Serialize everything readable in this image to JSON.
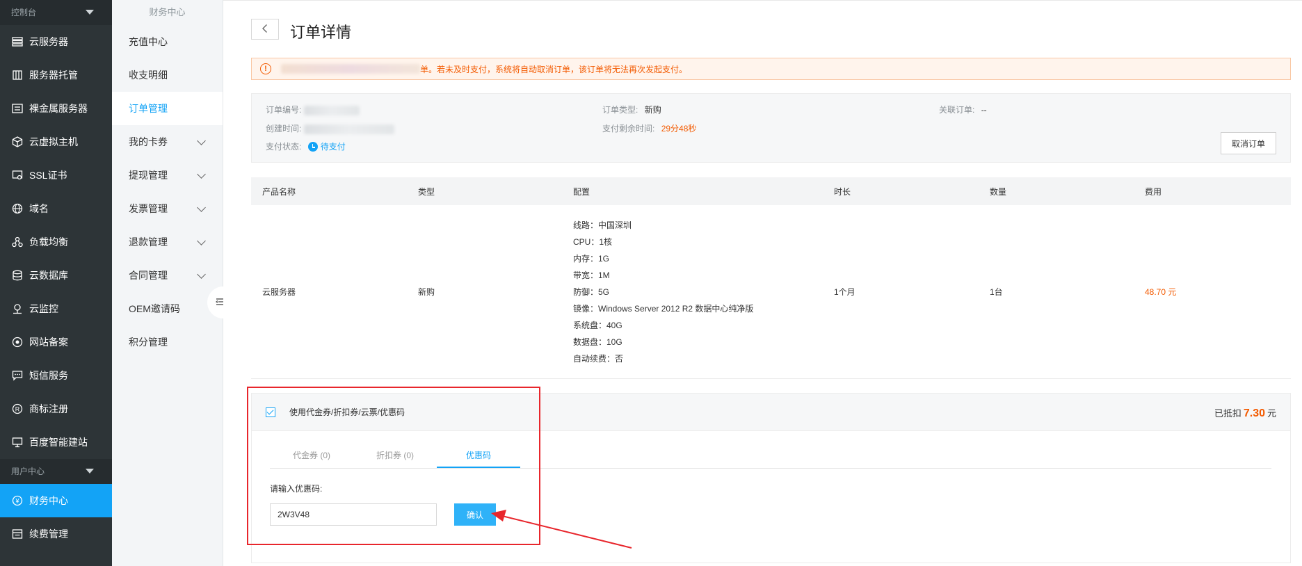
{
  "sidebar": {
    "section_console": "控制台",
    "section_user": "用户中心",
    "items": [
      {
        "label": "云服务器",
        "icon": "server-icon"
      },
      {
        "label": "服务器托管",
        "icon": "hosting-icon"
      },
      {
        "label": "裸金属服务器",
        "icon": "bare-metal-icon"
      },
      {
        "label": "云虚拟主机",
        "icon": "cube-icon"
      },
      {
        "label": "SSL证书",
        "icon": "certificate-icon"
      },
      {
        "label": "域名",
        "icon": "globe-icon"
      },
      {
        "label": "负载均衡",
        "icon": "load-balance-icon"
      },
      {
        "label": "云数据库",
        "icon": "database-icon"
      },
      {
        "label": "云监控",
        "icon": "monitor-icon"
      },
      {
        "label": "网站备案",
        "icon": "filing-icon"
      },
      {
        "label": "短信服务",
        "icon": "sms-icon"
      },
      {
        "label": "商标注册",
        "icon": "trademark-icon"
      },
      {
        "label": "百度智能建站",
        "icon": "site-builder-icon"
      }
    ],
    "user_items": [
      {
        "label": "财务中心",
        "icon": "yen-icon"
      },
      {
        "label": "续费管理",
        "icon": "renew-icon"
      }
    ]
  },
  "submenu": {
    "title": "财务中心",
    "items": [
      {
        "label": "充值中心"
      },
      {
        "label": "收支明细"
      },
      {
        "label": "订单管理"
      },
      {
        "label": "我的卡券"
      },
      {
        "label": "提现管理"
      },
      {
        "label": "发票管理"
      },
      {
        "label": "退款管理"
      },
      {
        "label": "合同管理"
      },
      {
        "label": "OEM邀请码"
      },
      {
        "label": "积分管理"
      }
    ]
  },
  "page": {
    "title": "订单详情"
  },
  "alert": {
    "text": "单。若未及时支付，系统将自动取消订单，该订单将无法再次发起支付。"
  },
  "order_info": {
    "order_no_label": "订单编号:",
    "created_label": "创建时间:",
    "pay_status_label": "支付状态:",
    "pay_status_value": "待支付",
    "order_type_label": "订单类型:",
    "order_type_value": "新购",
    "remaining_label": "支付剩余时间:",
    "remaining_value": "29分48秒",
    "related_label": "关联订单:",
    "related_value": "--",
    "cancel_button": "取消订单"
  },
  "table": {
    "headers": [
      "产品名称",
      "类型",
      "配置",
      "时长",
      "数量",
      "费用"
    ],
    "row": {
      "product": "云服务器",
      "type": "新购",
      "config": [
        "线路：中国深圳",
        "CPU：1核",
        "内存：1G",
        "带宽：1M",
        "防御：5G",
        "镜像：Windows Server 2012 R2 数据中心纯净版",
        "系统盘：40G",
        "数据盘：10G",
        "自动续费：否"
      ],
      "duration": "1个月",
      "quantity": "1台",
      "price": "48.70 元"
    }
  },
  "coupon": {
    "checkbox_label": "使用代金券/折扣券/云票/优惠码",
    "discount_prefix": "已抵扣",
    "discount_amount": "7.30",
    "discount_unit": "元",
    "tabs": [
      "代金券 (0)",
      "折扣券 (0)",
      "优惠码"
    ],
    "code_label": "请输入优惠码:",
    "code_value": "2W3V48",
    "confirm_button": "确认"
  },
  "colors": {
    "accent": "#13a3f6",
    "warning": "#f35a00",
    "sidebar_bg": "#2d3437",
    "annotation": "#e8262c"
  }
}
